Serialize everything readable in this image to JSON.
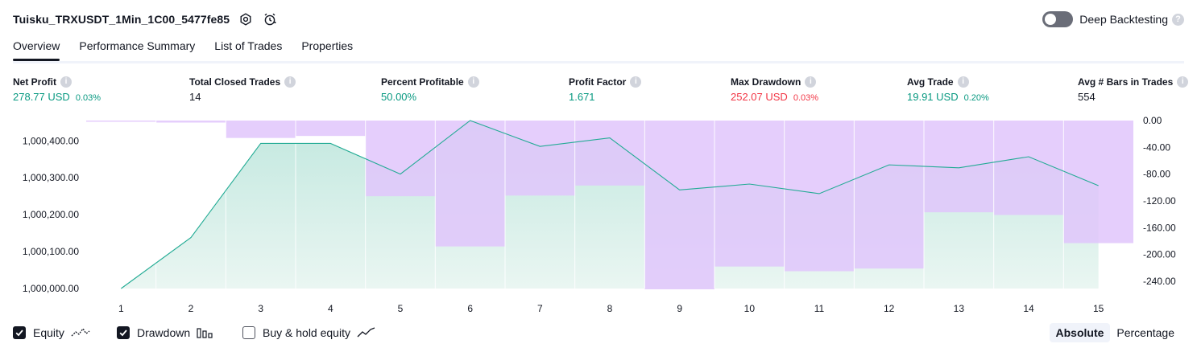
{
  "header": {
    "title": "Tuisku_TRXUSDT_1Min_1C00_5477fe85",
    "deep_backtesting_label": "Deep Backtesting",
    "help_glyph": "?"
  },
  "tabs": [
    "Overview",
    "Performance Summary",
    "List of Trades",
    "Properties"
  ],
  "metrics": [
    {
      "label": "Net Profit",
      "value": "278.77 USD",
      "pct": "0.03%",
      "tone": "pos"
    },
    {
      "label": "Total Closed Trades",
      "value": "14",
      "pct": "",
      "tone": "neu"
    },
    {
      "label": "Percent Profitable",
      "value": "50.00%",
      "pct": "",
      "tone": "pos"
    },
    {
      "label": "Profit Factor",
      "value": "1.671",
      "pct": "",
      "tone": "pos"
    },
    {
      "label": "Max Drawdown",
      "value": "252.07 USD",
      "pct": "0.03%",
      "tone": "neg"
    },
    {
      "label": "Avg Trade",
      "value": "19.91 USD",
      "pct": "0.20%",
      "tone": "pos"
    },
    {
      "label": "Avg # Bars in Trades",
      "value": "554",
      "pct": "",
      "tone": "neu"
    }
  ],
  "legend": {
    "equity": "Equity",
    "drawdown": "Drawdown",
    "buy_hold": "Buy & hold equity",
    "equity_checked": true,
    "drawdown_checked": true,
    "buy_hold_checked": false
  },
  "modes": {
    "absolute": "Absolute",
    "percentage": "Percentage",
    "active": "absolute"
  },
  "colors": {
    "equity_line": "#22ab94",
    "drawdown_fill": "#e1c5fb",
    "equity_fill_top": "#c2e8df",
    "equity_fill_bottom": "#eaf6f2",
    "positive": "#089981",
    "negative": "#f23645"
  },
  "chart_data": {
    "type": "area",
    "x": [
      1,
      2,
      3,
      4,
      5,
      6,
      7,
      8,
      9,
      10,
      11,
      12,
      13,
      14,
      15
    ],
    "series": [
      {
        "name": "Equity",
        "axis": "left",
        "values": [
          1000000.0,
          1000138.0,
          1000393.0,
          1000393.0,
          1000310.0,
          1000455.0,
          1000385.0,
          1000408.0,
          1000267.0,
          1000283.0,
          1000257.0,
          1000335.0,
          1000327.0,
          1000357.0,
          1000278.77
        ]
      },
      {
        "name": "Drawdown",
        "axis": "right",
        "values": [
          0,
          -3,
          -26,
          -23,
          -113,
          -188,
          -112,
          -97,
          -252,
          -218,
          -225,
          -221,
          -137,
          -141,
          -183
        ]
      }
    ],
    "left_ticks": [
      "1,000,000.00",
      "1,000,100.00",
      "1,000,200.00",
      "1,000,300.00",
      "1,000,400.00"
    ],
    "left_tick_values": [
      1000000,
      1000100,
      1000200,
      1000300,
      1000400
    ],
    "right_ticks": [
      "0.00",
      "-40.00",
      "-80.00",
      "-120.00",
      "-160.00",
      "-200.00",
      "-240.00"
    ],
    "right_tick_values": [
      0,
      -40,
      -80,
      -120,
      -160,
      -200,
      -240
    ],
    "left_ylim": [
      1000000,
      1000455
    ],
    "right_ylim": [
      -252,
      0
    ]
  }
}
